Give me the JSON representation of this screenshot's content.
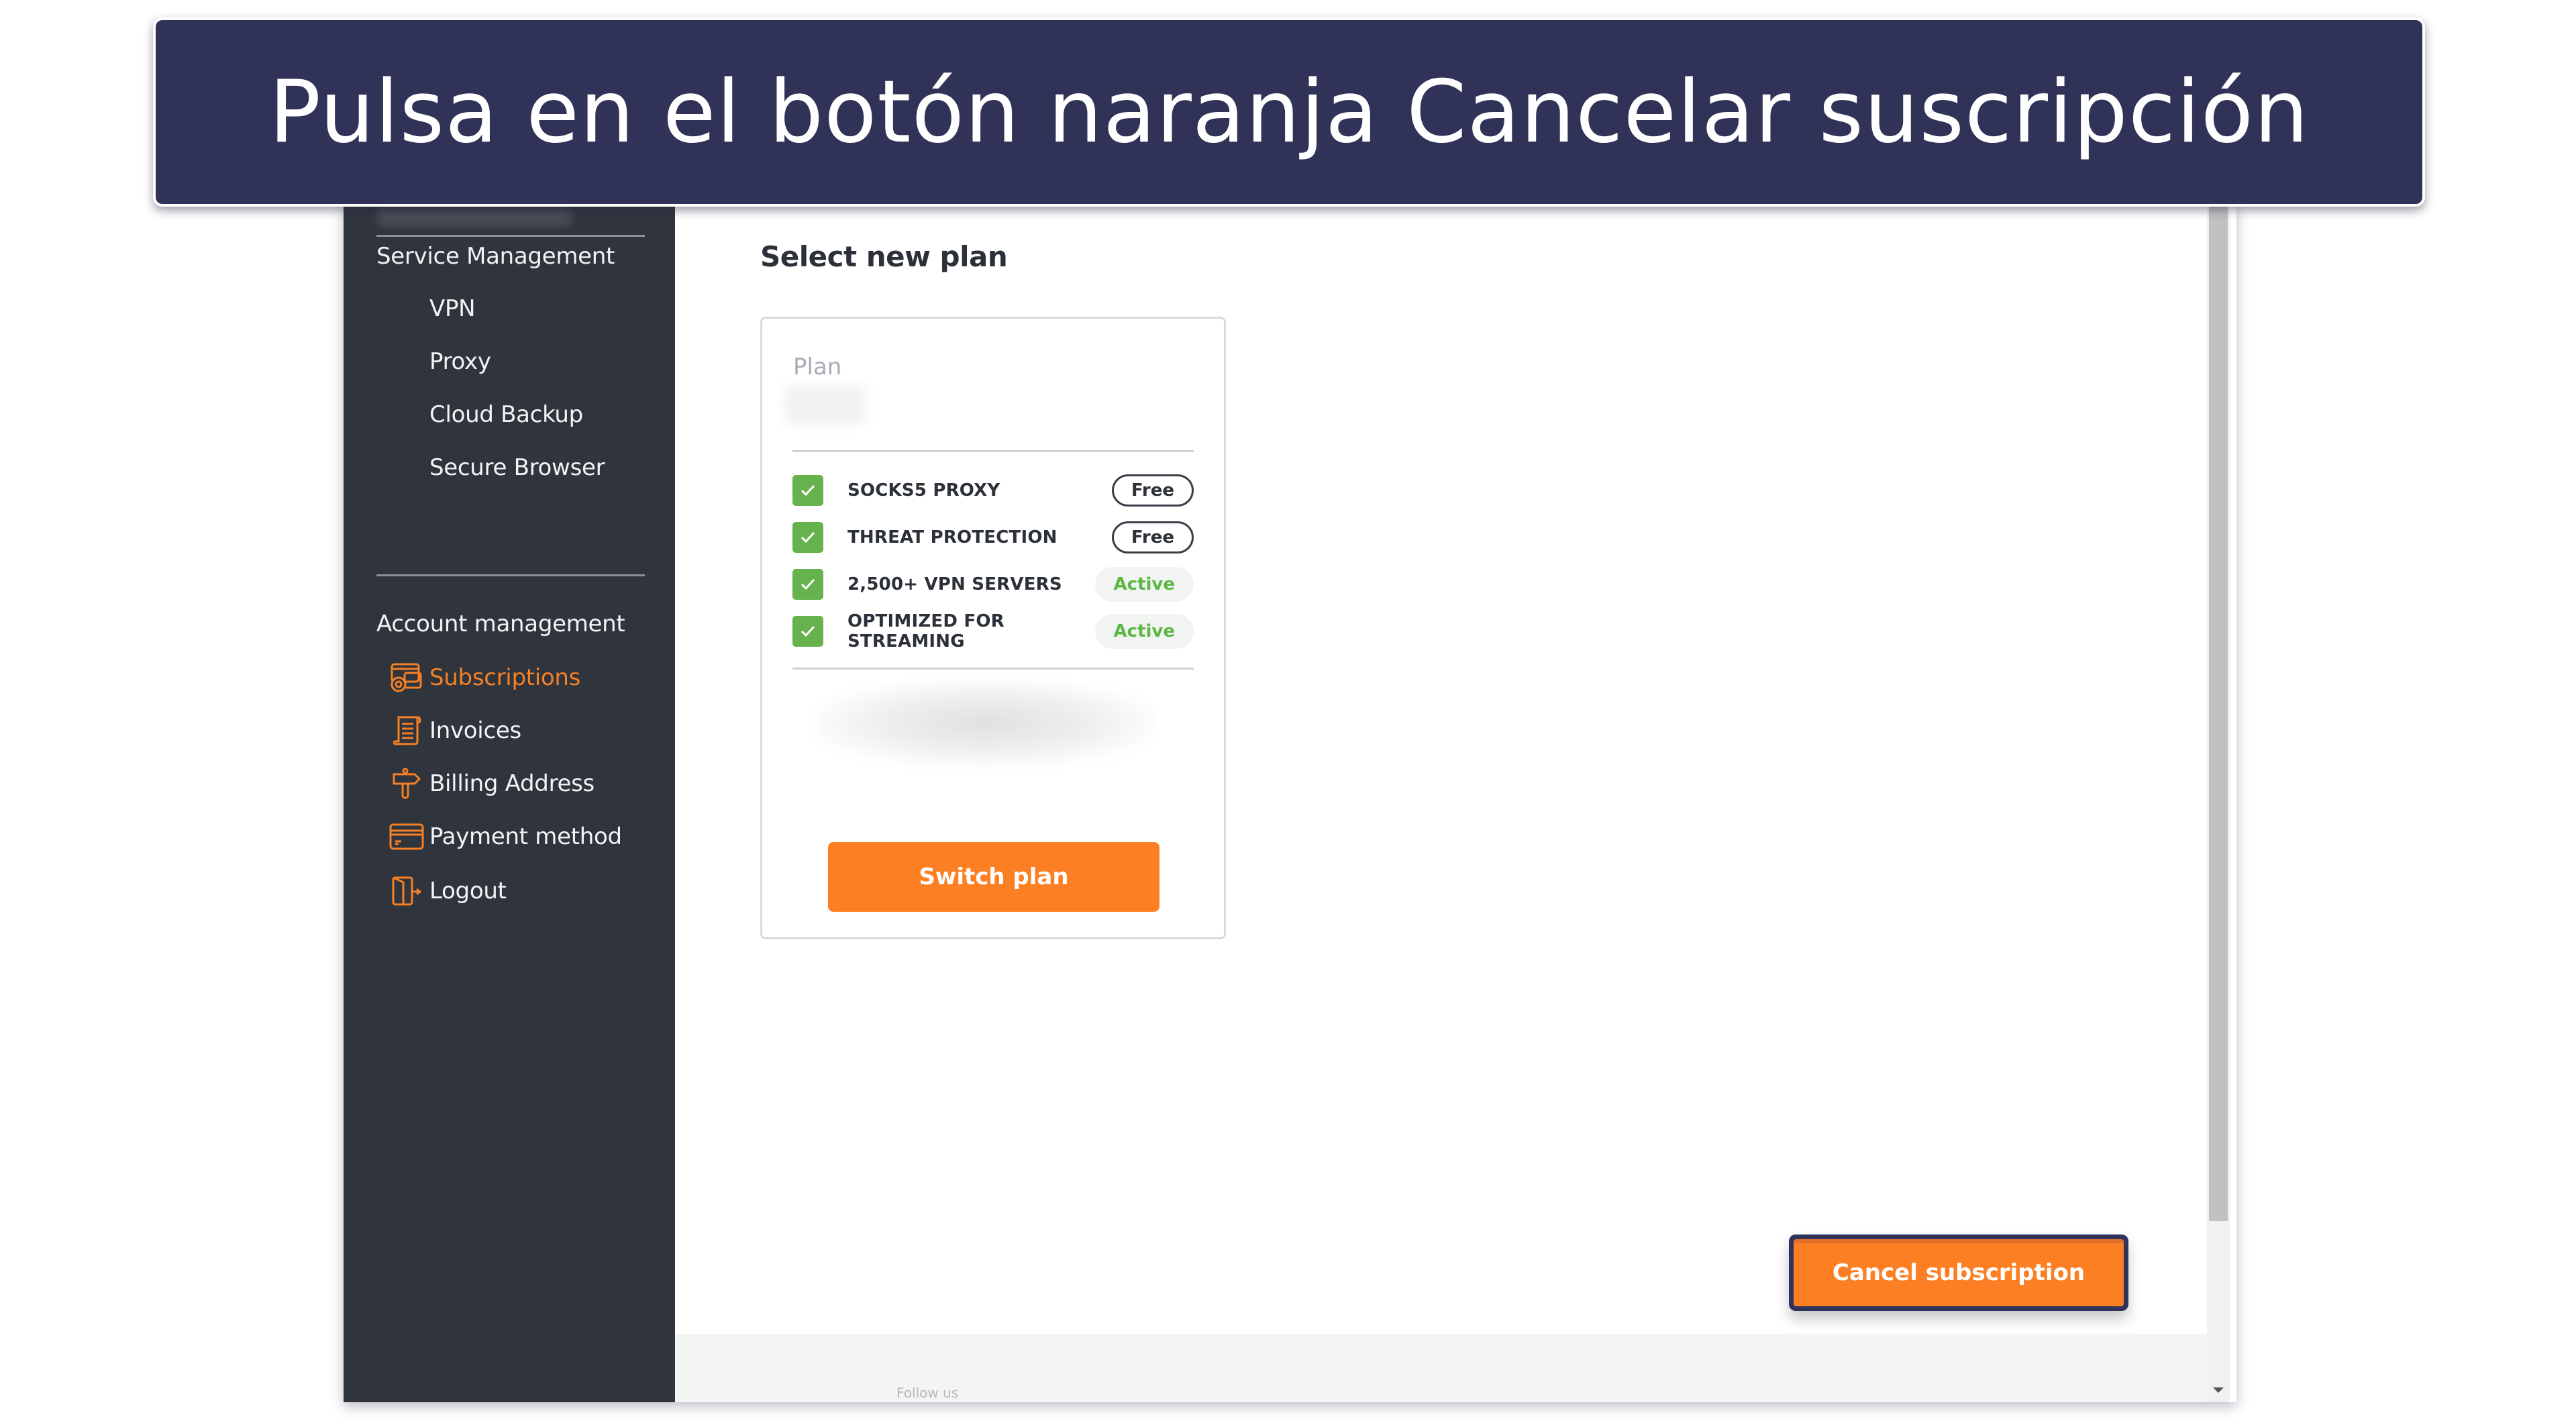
{
  "banner": {
    "instruction": "Pulsa en el botón naranja Cancelar suscripción"
  },
  "colors": {
    "accent_orange": "#fd7f24",
    "sidebar_bg": "#2f343d",
    "banner_bg": "#303257",
    "check_green": "#66b34e",
    "active_green": "#5cb746"
  },
  "sidebar": {
    "service_heading": "Service Management",
    "service_items": [
      {
        "label": "VPN"
      },
      {
        "label": "Proxy"
      },
      {
        "label": "Cloud Backup"
      },
      {
        "label": "Secure Browser"
      }
    ],
    "account_heading": "Account management",
    "account_items": [
      {
        "label": "Subscriptions",
        "icon": "subscriptions-icon",
        "active": true
      },
      {
        "label": "Invoices",
        "icon": "invoice-scroll-icon",
        "active": false
      },
      {
        "label": "Billing Address",
        "icon": "signpost-icon",
        "active": false
      },
      {
        "label": "Payment method",
        "icon": "credit-card-icon",
        "active": false
      },
      {
        "label": "Logout",
        "icon": "logout-door-icon",
        "active": false
      }
    ]
  },
  "main": {
    "title": "Select new plan",
    "plan_card": {
      "plan_label": "Plan",
      "features": [
        {
          "name": "SOCKS5 PROXY",
          "badge": "Free",
          "badge_type": "free"
        },
        {
          "name": "THREAT PROTECTION",
          "badge": "Free",
          "badge_type": "free"
        },
        {
          "name": "2,500+ VPN SERVERS",
          "badge": "Active",
          "badge_type": "active"
        },
        {
          "name": "OPTIMIZED FOR STREAMING",
          "badge": "Active",
          "badge_type": "active"
        }
      ],
      "switch_button": "Switch plan"
    },
    "cancel_button": "Cancel subscription",
    "footer_text": "Follow us"
  }
}
